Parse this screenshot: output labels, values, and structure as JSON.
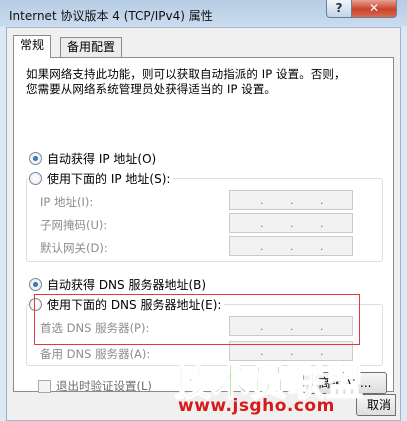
{
  "window": {
    "title": "Internet 协议版本 4 (TCP/IPv4) 属性",
    "help_label": "?",
    "close_label": "✕"
  },
  "tabs": [
    {
      "label": "常规",
      "active": true
    },
    {
      "label": "备用配置",
      "active": false
    }
  ],
  "description_line1": "如果网络支持此功能，则可以获取自动指派的 IP 设置。否则，",
  "description_line2": "您需要从网络系统管理员处获得适当的 IP 设置。",
  "ip_section": {
    "auto_label": "自动获得 IP 地址(O)",
    "manual_label": "使用下面的 IP 地址(S):",
    "selected": "auto",
    "fields": [
      {
        "label": "IP 地址(I):",
        "value": ". . ."
      },
      {
        "label": "子网掩码(U):",
        "value": ". . ."
      },
      {
        "label": "默认网关(D):",
        "value": ". . ."
      }
    ]
  },
  "dns_section": {
    "auto_label": "自动获得 DNS 服务器地址(B)",
    "manual_label": "使用下面的 DNS 服务器地址(E):",
    "selected": "auto",
    "fields": [
      {
        "label": "首选 DNS 服务器(P):",
        "value": ". . ."
      },
      {
        "label": "备用 DNS 服务器(A):",
        "value": ". . ."
      }
    ]
  },
  "validate_label": "退出时验证设置(L)",
  "advanced_label": "高级(V)...",
  "cancel_label": "取消",
  "watermark": {
    "title": "技术员联盟",
    "url": "www.jsgho.com"
  },
  "colors": {
    "highlight_border": "#e23a3a",
    "watermark_green": "#3fb51e",
    "watermark_red": "#d61b1b"
  }
}
